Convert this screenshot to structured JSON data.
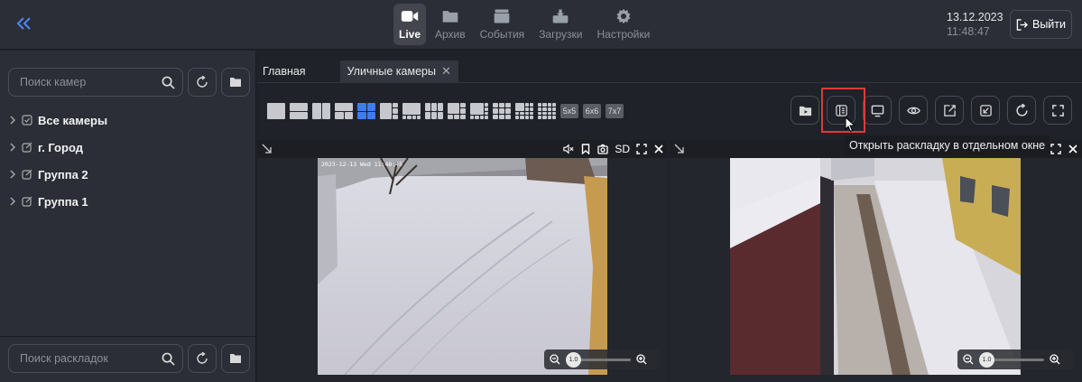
{
  "header": {
    "nav": [
      {
        "label": "Live",
        "icon": "camera-icon",
        "active": true
      },
      {
        "label": "Архив",
        "icon": "archive-folder-icon",
        "active": false
      },
      {
        "label": "События",
        "icon": "events-clapper-icon",
        "active": false
      },
      {
        "label": "Загрузки",
        "icon": "download-icon",
        "active": false
      },
      {
        "label": "Настройки",
        "icon": "gear-icon",
        "active": false
      }
    ],
    "date": "13.12.2023",
    "time": "11:48:47",
    "logout_label": "Выйти"
  },
  "sidebar": {
    "camera_search_placeholder": "Поиск камер",
    "tree": [
      {
        "label": "Все камеры"
      },
      {
        "label": "г. Город"
      },
      {
        "label": "Группа 2"
      },
      {
        "label": "Группа 1"
      }
    ],
    "layout_search_placeholder": "Поиск раскладок"
  },
  "tabs": [
    {
      "label": "Главная",
      "active": false
    },
    {
      "label": "Уличные камеры",
      "active": true,
      "close": "✕"
    }
  ],
  "layout_toolbar": {
    "text_layouts": [
      "5x5",
      "6x6",
      "7x7"
    ]
  },
  "tooltip": "Открыть раскладку в отдельном окне",
  "panes": [
    {
      "quality": "SD",
      "timestamp": "2023-12-13 Wed 11:48:45",
      "zoom": "1.0"
    },
    {
      "zoom": "1.0"
    }
  ],
  "colors": {
    "accent": "#3f7cf4",
    "highlight": "#e03a3a"
  }
}
